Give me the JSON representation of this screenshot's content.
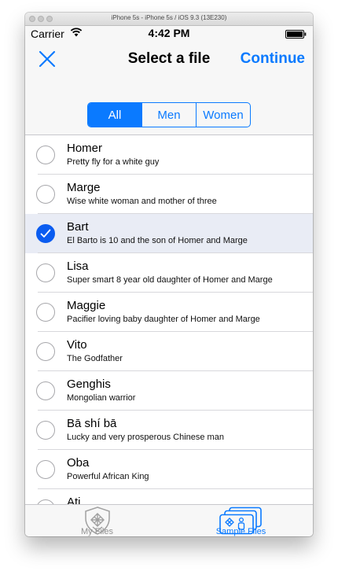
{
  "window": {
    "title": "iPhone 5s - iPhone 5s / iOS 9.3 (13E230)"
  },
  "status_bar": {
    "carrier": "Carrier",
    "time": "4:42 PM"
  },
  "nav": {
    "title": "Select a file",
    "continue_label": "Continue"
  },
  "segments": [
    {
      "label": "All",
      "active": true
    },
    {
      "label": "Men",
      "active": false
    },
    {
      "label": "Women",
      "active": false
    }
  ],
  "files": [
    {
      "title": "Homer",
      "subtitle": "Pretty fly for a white guy",
      "selected": false
    },
    {
      "title": "Marge",
      "subtitle": "Wise white woman and mother of three",
      "selected": false
    },
    {
      "title": "Bart",
      "subtitle": "El Barto is 10 and the son of Homer and Marge",
      "selected": true
    },
    {
      "title": "Lisa",
      "subtitle": "Super smart 8 year old daughter of Homer and Marge",
      "selected": false
    },
    {
      "title": "Maggie",
      "subtitle": "Pacifier loving baby daughter of Homer and Marge",
      "selected": false
    },
    {
      "title": "Vito",
      "subtitle": "The Godfather",
      "selected": false
    },
    {
      "title": "Genghis",
      "subtitle": "Mongolian warrior",
      "selected": false
    },
    {
      "title": "Bā shí bā",
      "subtitle": "Lucky and very prosperous Chinese man",
      "selected": false
    },
    {
      "title": "Oba",
      "subtitle": "Powerful African King",
      "selected": false
    },
    {
      "title": "Ati",
      "subtitle": "",
      "selected": false
    }
  ],
  "tabs": [
    {
      "label": "My Files",
      "icon": "shield-icon",
      "active": false
    },
    {
      "label": "Sample Files",
      "icon": "stacked-files-icon",
      "active": true
    }
  ],
  "colors": {
    "accent": "#0a7aff",
    "selected_row": "#e9ecf5",
    "checkmark_fill": "#0a5cf0"
  }
}
